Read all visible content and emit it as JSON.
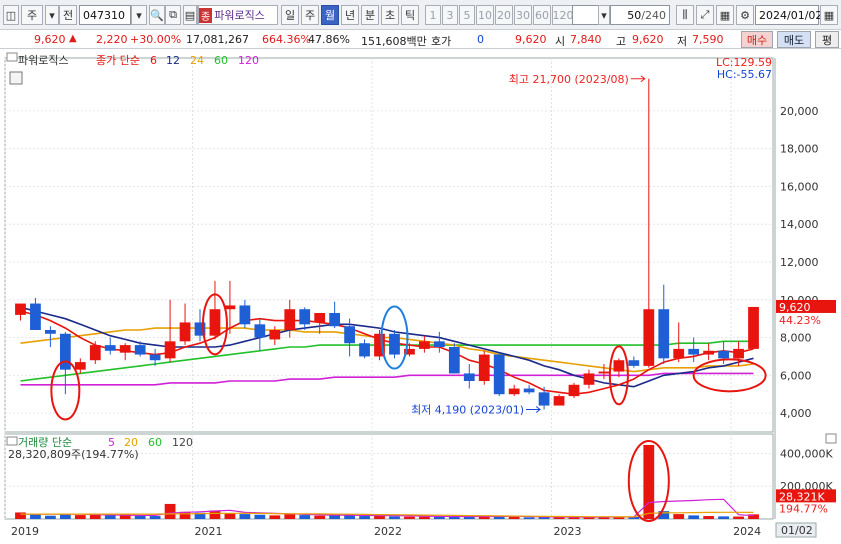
{
  "toolbar": {
    "market": "주",
    "market2": "전",
    "code": "047310",
    "name_badge": "종",
    "name": "파워로직스",
    "periods": [
      "일",
      "주",
      "월",
      "년",
      "분",
      "초",
      "틱"
    ],
    "active_period": "월",
    "intervals": [
      "1",
      "3",
      "5",
      "10",
      "20",
      "30",
      "60",
      "120"
    ],
    "count": "50",
    "count_total": "/240",
    "date": "2024/01/02"
  },
  "quote": {
    "price": "9,620",
    "change": "2,220",
    "change_pct": "+30.00%",
    "volume": "17,081,267",
    "vol_ratio": "664.36%",
    "turnover": "47.86%",
    "amount": "151,608백만",
    "hoga_label": "호가",
    "hoga_value": "0",
    "hoga_price": "9,620",
    "open_label": "시",
    "open": "7,840",
    "high_label": "고",
    "high": "9,620",
    "low_label": "저",
    "low": "7,590",
    "buy_label": "매수",
    "sell_label": "매도",
    "eval_label": "평"
  },
  "legend": {
    "stock_name": "파워로직스",
    "price_label": "종가 단순",
    "ma_periods": [
      "6",
      "12",
      "24",
      "60",
      "120"
    ],
    "lc": "LC:129.59",
    "hc": "HC:-55.67",
    "vol_label": "거래량 단순",
    "vol_ma_periods": [
      "5",
      "20",
      "60",
      "120"
    ],
    "vol_value": "28,320,809주(194.77%)"
  },
  "annotations": {
    "high_note": "최고 21,700 (2023/08)",
    "low_note": "최저 4,190 (2023/01)",
    "price_tag": "9,620",
    "price_tag_pct": "44.23%",
    "vol_tag": "28,321K",
    "vol_tag_pct": "194.77%",
    "date_tag": "01/02"
  },
  "colors": {
    "up": "#e8140e",
    "down": "#1f5fd6",
    "ma6": "#e8140e",
    "ma12": "#1b2a8a",
    "ma24": "#e8a000",
    "ma60": "#22c02a",
    "ma120": "#d020d8",
    "circle_red": "#e8140e",
    "circle_blue": "#1e7fe0"
  },
  "chart_data": {
    "type": "candlestick",
    "title": "파워로직스 월봉",
    "price_axis": {
      "ticks": [
        4000,
        6000,
        8000,
        10000,
        12000,
        14000,
        16000,
        18000,
        20000
      ],
      "labels": [
        "4,000",
        "6,000",
        "8,000",
        "10,000",
        "12,000",
        "14,000",
        "16,000",
        "18,000",
        "20,000"
      ],
      "range": [
        3000,
        22800
      ]
    },
    "volume_axis": {
      "ticks": [
        200000,
        400000
      ],
      "labels": [
        "200,000K",
        "400,000K"
      ],
      "range": [
        0,
        470000
      ]
    },
    "x_labels": [
      "2019",
      "2021",
      "2022",
      "2023",
      "2024"
    ],
    "candles": [
      {
        "o": 9200,
        "h": 9300,
        "l": 8900,
        "c": 9800,
        "v": 40000
      },
      {
        "o": 9800,
        "h": 10100,
        "l": 8400,
        "c": 8400,
        "v": 30000
      },
      {
        "o": 8400,
        "h": 8600,
        "l": 7500,
        "c": 8200,
        "v": 20000
      },
      {
        "o": 8200,
        "h": 8300,
        "l": 5000,
        "c": 6300,
        "v": 32000
      },
      {
        "o": 6300,
        "h": 6900,
        "l": 6100,
        "c": 6700,
        "v": 24000
      },
      {
        "o": 6800,
        "h": 7800,
        "l": 6600,
        "c": 7600,
        "v": 28000
      },
      {
        "o": 7600,
        "h": 8000,
        "l": 7100,
        "c": 7300,
        "v": 22000
      },
      {
        "o": 7200,
        "h": 7700,
        "l": 6800,
        "c": 7600,
        "v": 22000
      },
      {
        "o": 7600,
        "h": 7800,
        "l": 7000,
        "c": 7100,
        "v": 20000
      },
      {
        "o": 7100,
        "h": 7400,
        "l": 6500,
        "c": 6800,
        "v": 18000
      },
      {
        "o": 6900,
        "h": 10000,
        "l": 6700,
        "c": 7800,
        "v": 92000
      },
      {
        "o": 7800,
        "h": 9800,
        "l": 7600,
        "c": 8800,
        "v": 44000
      },
      {
        "o": 8800,
        "h": 9500,
        "l": 7800,
        "c": 8100,
        "v": 38000
      },
      {
        "o": 8100,
        "h": 11000,
        "l": 7900,
        "c": 9500,
        "v": 52000
      },
      {
        "o": 9500,
        "h": 11000,
        "l": 8200,
        "c": 9700,
        "v": 36000
      },
      {
        "o": 9700,
        "h": 10000,
        "l": 8500,
        "c": 8700,
        "v": 30000
      },
      {
        "o": 8700,
        "h": 9000,
        "l": 7300,
        "c": 8000,
        "v": 26000
      },
      {
        "o": 7900,
        "h": 8600,
        "l": 7600,
        "c": 8400,
        "v": 22000
      },
      {
        "o": 8400,
        "h": 10000,
        "l": 8000,
        "c": 9500,
        "v": 28000
      },
      {
        "o": 9500,
        "h": 9600,
        "l": 8400,
        "c": 8700,
        "v": 24000
      },
      {
        "o": 8800,
        "h": 9100,
        "l": 8200,
        "c": 9300,
        "v": 20000
      },
      {
        "o": 9300,
        "h": 9900,
        "l": 8500,
        "c": 8600,
        "v": 22000
      },
      {
        "o": 8600,
        "h": 9000,
        "l": 7000,
        "c": 7700,
        "v": 26000
      },
      {
        "o": 7700,
        "h": 7900,
        "l": 6900,
        "c": 7000,
        "v": 18000
      },
      {
        "o": 7000,
        "h": 8400,
        "l": 6800,
        "c": 8200,
        "v": 20000
      },
      {
        "o": 8200,
        "h": 8400,
        "l": 6900,
        "c": 7100,
        "v": 16000
      },
      {
        "o": 7100,
        "h": 7700,
        "l": 7000,
        "c": 7400,
        "v": 14000
      },
      {
        "o": 7400,
        "h": 8100,
        "l": 7200,
        "c": 7800,
        "v": 14000
      },
      {
        "o": 7800,
        "h": 8300,
        "l": 7200,
        "c": 7500,
        "v": 14000
      },
      {
        "o": 7500,
        "h": 7700,
        "l": 6100,
        "c": 6100,
        "v": 16000
      },
      {
        "o": 6100,
        "h": 6600,
        "l": 5300,
        "c": 5700,
        "v": 14000
      },
      {
        "o": 5700,
        "h": 7300,
        "l": 5500,
        "c": 7100,
        "v": 18000
      },
      {
        "o": 7100,
        "h": 7200,
        "l": 4900,
        "c": 5000,
        "v": 18000
      },
      {
        "o": 5000,
        "h": 5500,
        "l": 4900,
        "c": 5300,
        "v": 12000
      },
      {
        "o": 5300,
        "h": 5500,
        "l": 5000,
        "c": 5100,
        "v": 10000
      },
      {
        "o": 5100,
        "h": 5400,
        "l": 4190,
        "c": 4400,
        "v": 11000
      },
      {
        "o": 4400,
        "h": 5000,
        "l": 4400,
        "c": 4900,
        "v": 10000
      },
      {
        "o": 4900,
        "h": 5600,
        "l": 4800,
        "c": 5500,
        "v": 12000
      },
      {
        "o": 5500,
        "h": 6300,
        "l": 5300,
        "c": 6100,
        "v": 12000
      },
      {
        "o": 6100,
        "h": 6600,
        "l": 5800,
        "c": 6200,
        "v": 12000
      },
      {
        "o": 6200,
        "h": 6900,
        "l": 5900,
        "c": 6800,
        "v": 14000
      },
      {
        "o": 6800,
        "h": 7000,
        "l": 6400,
        "c": 6500,
        "v": 12000
      },
      {
        "o": 6500,
        "h": 21700,
        "l": 6400,
        "c": 9500,
        "v": 452000
      },
      {
        "o": 9500,
        "h": 10800,
        "l": 6600,
        "c": 6900,
        "v": 48000
      },
      {
        "o": 6900,
        "h": 8800,
        "l": 6700,
        "c": 7400,
        "v": 30000
      },
      {
        "o": 7400,
        "h": 8000,
        "l": 6700,
        "c": 7100,
        "v": 22000
      },
      {
        "o": 7100,
        "h": 7700,
        "l": 6800,
        "c": 7300,
        "v": 18000
      },
      {
        "o": 7300,
        "h": 7800,
        "l": 6600,
        "c": 6900,
        "v": 16000
      },
      {
        "o": 6900,
        "h": 7800,
        "l": 6500,
        "c": 7400,
        "v": 15000
      },
      {
        "o": 7400,
        "h": 9620,
        "l": 7590,
        "c": 9620,
        "v": 28321
      }
    ],
    "ma": {
      "6": [
        9400,
        9200,
        8900,
        8500,
        8000,
        7600,
        7400,
        7300,
        7200,
        7100,
        7200,
        7500,
        7700,
        8000,
        8500,
        8900,
        9000,
        8900,
        8900,
        8900,
        8800,
        8700,
        8500,
        8200,
        7900,
        7700,
        7600,
        7500,
        7500,
        7200,
        6800,
        6600,
        6300,
        5900,
        5600,
        5200,
        5100,
        5000,
        5100,
        5300,
        5500,
        5800,
        6300,
        6700,
        6900,
        7000,
        7200,
        7300,
        7200,
        7400
      ],
      "12": [
        9600,
        9400,
        9200,
        9000,
        8700,
        8400,
        8100,
        7900,
        7700,
        7600,
        7500,
        7500,
        7500,
        7500,
        7600,
        7800,
        8000,
        8200,
        8400,
        8500,
        8600,
        8700,
        8700,
        8600,
        8500,
        8300,
        8200,
        8100,
        8000,
        7800,
        7600,
        7400,
        7200,
        7000,
        6800,
        6500,
        6300,
        6000,
        5800,
        5600,
        5500,
        5400,
        5700,
        6000,
        6100,
        6200,
        6400,
        6500,
        6700,
        6900
      ],
      "24": [
        7700,
        7800,
        7900,
        8000,
        8100,
        8200,
        8300,
        8400,
        8400,
        8500,
        8500,
        8500,
        8500,
        8500,
        8500,
        8500,
        8400,
        8400,
        8400,
        8300,
        8300,
        8300,
        8200,
        8100,
        8000,
        8000,
        7900,
        7800,
        7700,
        7600,
        7400,
        7300,
        7100,
        7000,
        6900,
        6800,
        6700,
        6600,
        6500,
        6400,
        6300,
        6200,
        6300,
        6400,
        6400,
        6400,
        6500,
        6500,
        6500,
        6600
      ],
      "60": [
        5700,
        5800,
        5900,
        6000,
        6100,
        6200,
        6300,
        6400,
        6500,
        6600,
        6700,
        6800,
        6900,
        7000,
        7100,
        7200,
        7300,
        7400,
        7500,
        7500,
        7600,
        7600,
        7600,
        7600,
        7600,
        7600,
        7600,
        7600,
        7600,
        7600,
        7600,
        7600,
        7600,
        7600,
        7600,
        7600,
        7600,
        7600,
        7600,
        7600,
        7600,
        7600,
        7600,
        7600,
        7700,
        7700,
        7700,
        7800,
        7800,
        7800
      ],
      "120": [
        5500,
        5500,
        5500,
        5500,
        5500,
        5500,
        5500,
        5500,
        5500,
        5500,
        5600,
        5600,
        5600,
        5600,
        5700,
        5700,
        5700,
        5700,
        5800,
        5800,
        5800,
        5900,
        5900,
        5900,
        5900,
        5900,
        6000,
        6000,
        6000,
        6000,
        6000,
        6000,
        6000,
        6000,
        6000,
        6000,
        6000,
        6000,
        6000,
        6000,
        6000,
        6000,
        6000,
        6100,
        6100,
        6100,
        6100,
        6100,
        6100,
        6100
      ]
    },
    "vol_ma5": [
      30000,
      30000,
      30000,
      30000,
      29000,
      27000,
      25000,
      24000,
      22000,
      22000,
      36000,
      41000,
      44000,
      49000,
      53000,
      40000,
      38000,
      34000,
      32000,
      28000,
      25000,
      24000,
      24000,
      22000,
      21000,
      20000,
      19000,
      18000,
      16000,
      15000,
      15000,
      15000,
      16000,
      16000,
      15000,
      13000,
      12000,
      11000,
      11000,
      11000,
      12000,
      12000,
      100000,
      107000,
      110000,
      113000,
      118000,
      120000,
      26000,
      20000
    ],
    "vol_ma20": [
      30000,
      30000,
      30000,
      30000,
      30000,
      30000,
      30000,
      30000,
      30000,
      30000,
      31000,
      32000,
      33000,
      34000,
      35000,
      35000,
      34000,
      33000,
      32000,
      32000,
      31000,
      30000,
      29000,
      28000,
      27000,
      26000,
      25000,
      24000,
      23000,
      22000,
      21000,
      20000,
      19000,
      18000,
      17000,
      16000,
      15000,
      15000,
      14000,
      14000,
      13000,
      13000,
      35000,
      37000,
      38000,
      39000,
      40000,
      41000,
      41000,
      40000
    ]
  }
}
